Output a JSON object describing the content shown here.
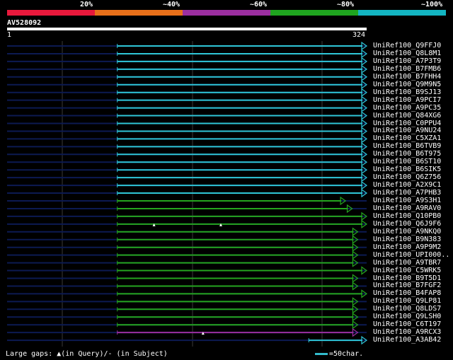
{
  "scale": {
    "labels": [
      "20%",
      "~40%",
      "~60%",
      "~80%",
      "~100%"
    ],
    "colors": [
      "#e8193c",
      "#e8701a",
      "#9b2fa0",
      "#1fa51f",
      "#13b5c2"
    ]
  },
  "query": {
    "name": "AV528092",
    "start_label": "1",
    "end_label": "324"
  },
  "colors": {
    "cyan": "#2fc6d8",
    "green": "#25a51f",
    "purple": "#9b2fa0",
    "navy": "#0c1a52",
    "gridline": "#3a3a3a"
  },
  "hits": [
    {
      "label": "UniRef100_Q9FFJ0",
      "color": "cyan",
      "start": 100,
      "end": 324
    },
    {
      "label": "UniRef100_Q8L8M1",
      "color": "cyan",
      "start": 100,
      "end": 324
    },
    {
      "label": "UniRef100_A7P3T9",
      "color": "cyan",
      "start": 100,
      "end": 324
    },
    {
      "label": "UniRef100_B7FMB6",
      "color": "cyan",
      "start": 100,
      "end": 324
    },
    {
      "label": "UniRef100_B7FHH4",
      "color": "cyan",
      "start": 100,
      "end": 324
    },
    {
      "label": "UniRef100_Q9M9N5",
      "color": "cyan",
      "start": 100,
      "end": 324
    },
    {
      "label": "UniRef100_B9SJ13",
      "color": "cyan",
      "start": 100,
      "end": 324
    },
    {
      "label": "UniRef100_A9PCI7",
      "color": "cyan",
      "start": 100,
      "end": 324
    },
    {
      "label": "UniRef100_A9PC35",
      "color": "cyan",
      "start": 100,
      "end": 324
    },
    {
      "label": "UniRef100_Q84XG6",
      "color": "cyan",
      "start": 100,
      "end": 324
    },
    {
      "label": "UniRef100_C0PPU4",
      "color": "cyan",
      "start": 100,
      "end": 324
    },
    {
      "label": "UniRef100_A9NU24",
      "color": "cyan",
      "start": 100,
      "end": 324
    },
    {
      "label": "UniRef100_C5XZA1",
      "color": "cyan",
      "start": 100,
      "end": 324
    },
    {
      "label": "UniRef100_B6TVB9",
      "color": "cyan",
      "start": 100,
      "end": 324
    },
    {
      "label": "UniRef100_B6T975",
      "color": "cyan",
      "start": 100,
      "end": 324
    },
    {
      "label": "UniRef100_B6ST10",
      "color": "cyan",
      "start": 100,
      "end": 324
    },
    {
      "label": "UniRef100_B6SIK5",
      "color": "cyan",
      "start": 100,
      "end": 324
    },
    {
      "label": "UniRef100_Q6Z756",
      "color": "cyan",
      "start": 100,
      "end": 324
    },
    {
      "label": "UniRef100_A2X9C1",
      "color": "cyan",
      "start": 100,
      "end": 324
    },
    {
      "label": "UniRef100_A7PHB3",
      "color": "cyan",
      "start": 100,
      "end": 324
    },
    {
      "label": "UniRef100_A9S3H1",
      "color": "green",
      "start": 100,
      "end": 305
    },
    {
      "label": "UniRef100_A9RAV0",
      "color": "green",
      "start": 100,
      "end": 311
    },
    {
      "label": "UniRef100_Q10PB0",
      "color": "green",
      "start": 100,
      "end": 324
    },
    {
      "label": "UniRef100_Q6J9F6",
      "color": "green",
      "start": 100,
      "end": 324,
      "gaps": [
        133,
        193
      ]
    },
    {
      "label": "UniRef100_A9NKQ0",
      "color": "green",
      "start": 100,
      "end": 316
    },
    {
      "label": "UniRef100_B9N383",
      "color": "green",
      "start": 100,
      "end": 316
    },
    {
      "label": "UniRef100_A9P9M2",
      "color": "green",
      "start": 100,
      "end": 316
    },
    {
      "label": "UniRef100_UPI000..",
      "color": "green",
      "start": 100,
      "end": 316
    },
    {
      "label": "UniRef100_A9TBR7",
      "color": "green",
      "start": 100,
      "end": 316
    },
    {
      "label": "UniRef100_C5WRK5",
      "color": "green",
      "start": 100,
      "end": 324
    },
    {
      "label": "UniRef100_B9T5D1",
      "color": "green",
      "start": 100,
      "end": 316
    },
    {
      "label": "UniRef100_B7FGF2",
      "color": "green",
      "start": 100,
      "end": 316
    },
    {
      "label": "UniRef100_B4FAP8",
      "color": "green",
      "start": 100,
      "end": 324
    },
    {
      "label": "UniRef100_Q9LP81",
      "color": "green",
      "start": 100,
      "end": 316
    },
    {
      "label": "UniRef100_Q8LDS7",
      "color": "green",
      "start": 100,
      "end": 316
    },
    {
      "label": "UniRef100_Q9LSH0",
      "color": "green",
      "start": 100,
      "end": 316
    },
    {
      "label": "UniRef100_C6T197",
      "color": "green",
      "start": 100,
      "end": 316
    },
    {
      "label": "UniRef100_A9RCX3",
      "color": "purple",
      "start": 100,
      "end": 316,
      "gaps": [
        177
      ]
    },
    {
      "label": "UniRef100_A3AB42",
      "color": "cyan",
      "start": 272,
      "end": 324
    }
  ],
  "legend": {
    "large_gaps": "Large gaps: ▲(in Query)/- (in Subject)",
    "scale_note": "=50char."
  }
}
